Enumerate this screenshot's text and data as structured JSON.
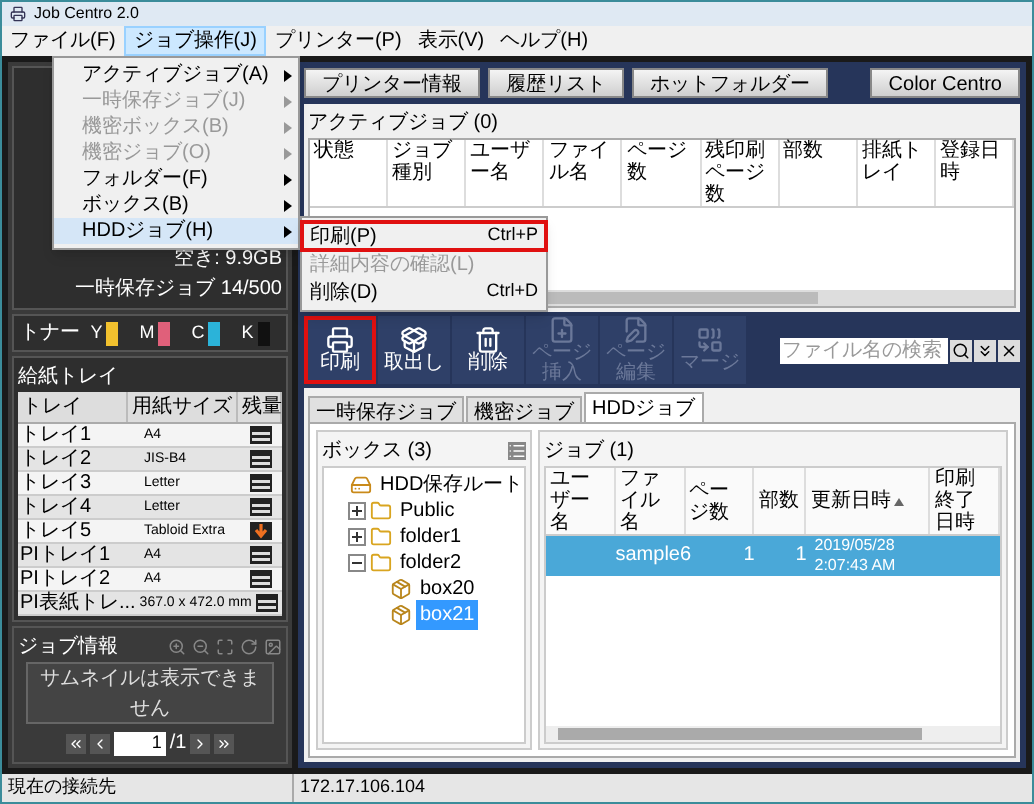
{
  "window": {
    "title": "Job Centro 2.0"
  },
  "menu_bar": [
    {
      "label": "ファイル(F)",
      "selected": false
    },
    {
      "label": "ジョブ操作(J)",
      "selected": true
    },
    {
      "label": "プリンター(P)",
      "selected": false
    },
    {
      "label": "表示(V)",
      "selected": false
    },
    {
      "label": "ヘルプ(H)",
      "selected": false
    }
  ],
  "dropdown_menu": [
    {
      "label": "アクティブジョブ(A)",
      "disabled": false,
      "selected": false
    },
    {
      "label": "一時保存ジョブ(J)",
      "disabled": true,
      "selected": false
    },
    {
      "label": "機密ボックス(B)",
      "disabled": true,
      "selected": false
    },
    {
      "label": "機密ジョブ(O)",
      "disabled": true,
      "selected": false
    },
    {
      "label": "フォルダー(F)",
      "disabled": false,
      "selected": false
    },
    {
      "label": "ボックス(B)",
      "disabled": false,
      "selected": false
    },
    {
      "label": "HDDジョブ(H)",
      "disabled": false,
      "selected": true
    }
  ],
  "submenu": [
    {
      "label": "印刷(P)",
      "shortcut": "Ctrl+P",
      "disabled": false,
      "annotated": true
    },
    {
      "label": "詳細内容の確認(L)",
      "disabled": true,
      "annotated": false
    },
    {
      "label": "削除(D)",
      "shortcut": "Ctrl+D",
      "disabled": false,
      "annotated": false
    }
  ],
  "status_panel": {
    "free_space": "空き: 9.9GB",
    "held_jobs": "一時保存ジョブ 14/500"
  },
  "toner": {
    "title": "トナー",
    "items": [
      {
        "label": "Y",
        "color": "#f2c12e",
        "level": 1
      },
      {
        "label": "M",
        "color": "#e0607a",
        "level": 1
      },
      {
        "label": "C",
        "color": "#2bb3d9",
        "level": 1
      },
      {
        "label": "K",
        "color": "#111111",
        "level": 1
      }
    ]
  },
  "trays": {
    "title": "給紙トレイ",
    "columns": [
      "トレイ",
      "用紙サイズ",
      "残量"
    ],
    "rows": [
      {
        "tray": "トレイ1",
        "size": "A4",
        "empty": false
      },
      {
        "tray": "トレイ2",
        "size": "JIS-B4",
        "empty": false
      },
      {
        "tray": "トレイ3",
        "size": "Letter",
        "empty": false
      },
      {
        "tray": "トレイ4",
        "size": "Letter",
        "empty": false
      },
      {
        "tray": "トレイ5",
        "size": "Tabloid Extra",
        "empty": true
      },
      {
        "tray": "PIトレイ1",
        "size": "A4",
        "empty": false
      },
      {
        "tray": "PIトレイ2",
        "size": "A4",
        "empty": false
      },
      {
        "tray": "PI表紙トレ...",
        "size": "367.0 x 472.0 mm",
        "empty": false
      }
    ]
  },
  "job_info": {
    "title": "ジョブ情報",
    "thumbnail_message": "サムネイルは表示できません",
    "page": "1",
    "page_total": "/1"
  },
  "top_buttons": [
    "プリンター情報",
    "履歴リスト",
    "ホットフォルダー",
    "Color Centro"
  ],
  "active_jobs": {
    "title": "アクティブジョブ (0)",
    "columns": [
      "状態",
      "ジョブ種別",
      "ユーザー名",
      "ファイル名",
      "ページ数",
      "残印刷ページ数",
      "部数",
      "排紙トレイ",
      "登録日時"
    ]
  },
  "toolbar": [
    {
      "label": "印刷",
      "kind": "print",
      "disabled": false,
      "annotated": true
    },
    {
      "label": "取出し",
      "kind": "take_out",
      "disabled": false,
      "annotated": false
    },
    {
      "label": "削除",
      "kind": "delete",
      "disabled": false,
      "annotated": false
    },
    {
      "label": "ページ挿入",
      "kind": "insert",
      "disabled": true,
      "annotated": false
    },
    {
      "label": "ページ編集",
      "kind": "edit",
      "disabled": true,
      "annotated": false
    },
    {
      "label": "マージ",
      "kind": "merge",
      "disabled": true,
      "annotated": false
    }
  ],
  "search": {
    "placeholder": "ファイル名の検索"
  },
  "tabs": [
    {
      "label": "一時保存ジョブ",
      "selected": false
    },
    {
      "label": "機密ジョブ",
      "selected": false
    },
    {
      "label": "HDDジョブ",
      "selected": true
    }
  ],
  "boxes": {
    "title": "ボックス (3)",
    "tree": [
      {
        "label": "HDD保存ルート",
        "kind": "root",
        "selected": false,
        "children": [
          {
            "label": "Public",
            "kind": "folder",
            "expanded": false,
            "selected": false
          },
          {
            "label": "folder1",
            "kind": "folder",
            "expanded": false,
            "selected": false
          },
          {
            "label": "folder2",
            "kind": "folder",
            "expanded": true,
            "selected": false,
            "children": [
              {
                "label": "box20",
                "kind": "box",
                "selected": false
              },
              {
                "label": "box21",
                "kind": "box",
                "selected": true
              }
            ]
          }
        ]
      }
    ]
  },
  "jobs": {
    "title": "ジョブ (1)",
    "columns": [
      {
        "label": "ユーザー名",
        "sorted": false
      },
      {
        "label": "ファイル名",
        "sorted": false
      },
      {
        "label": "ページ数",
        "sorted": false
      },
      {
        "label": "部数",
        "sorted": false
      },
      {
        "label": "更新日時",
        "sorted": true
      },
      {
        "label": "印刷終了日時",
        "sorted": false
      }
    ],
    "rows": [
      {
        "file": "sample6",
        "pages": "1",
        "copies": "1",
        "updated": "2019/05/28 2:07:43 AM",
        "selected": true
      }
    ]
  },
  "status_bar": {
    "label": "現在の接続先",
    "address": "172.17.106.104"
  }
}
